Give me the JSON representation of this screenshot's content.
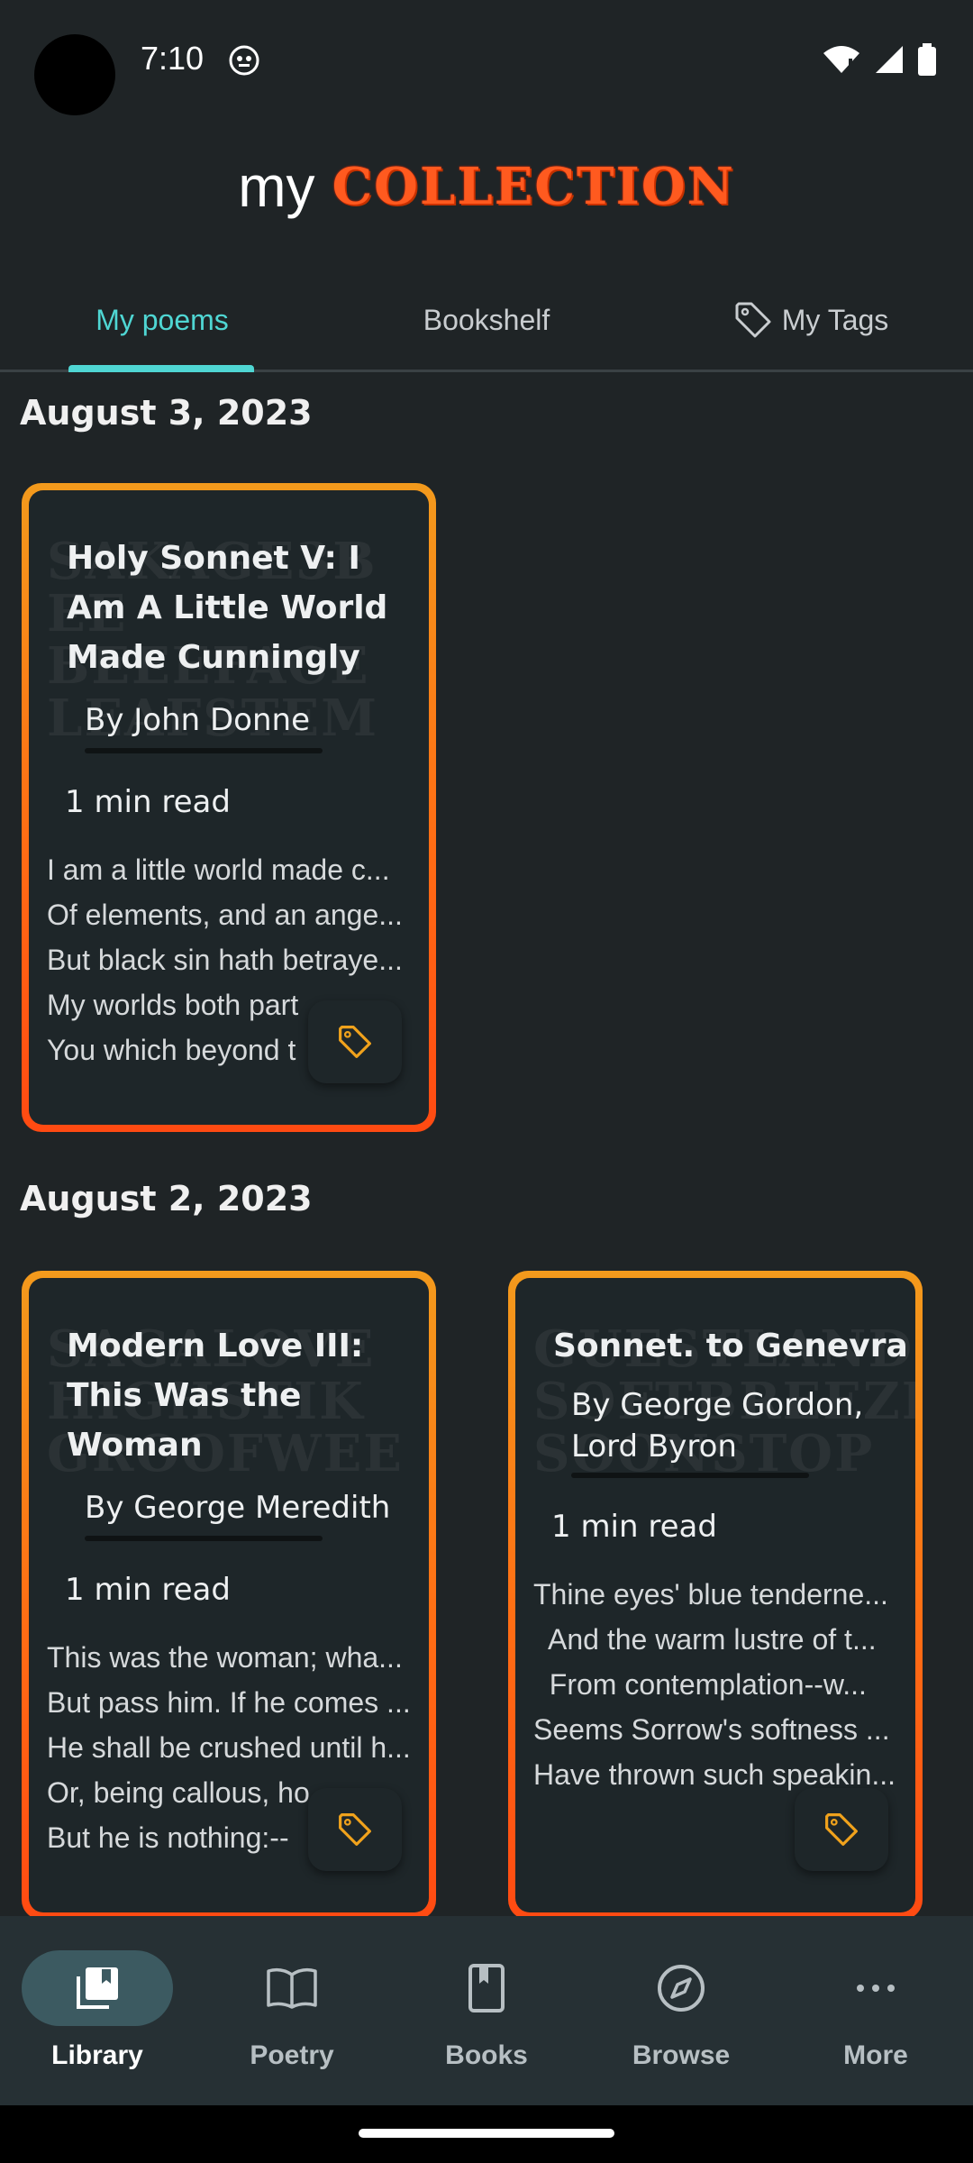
{
  "status_bar": {
    "time": "7:10"
  },
  "header": {
    "prefix": "my",
    "title": "COLLECTION"
  },
  "tabs": [
    {
      "label": "My poems",
      "active": true
    },
    {
      "label": "Bookshelf",
      "active": false
    },
    {
      "label": "My Tags",
      "active": false,
      "icon": "tag-icon"
    }
  ],
  "sections": [
    {
      "date": "August 3, 2023",
      "cards": [
        {
          "title": "Holy Sonnet V: I Am A Little World Made Cunningly",
          "author": "By John Donne",
          "read_time": "1 min read",
          "lines": [
            "I am a little world made c...",
            "Of elements, and an ange...",
            "But black sin hath betraye...",
            "My worlds both part",
            "You which beyond t"
          ]
        }
      ]
    },
    {
      "date": "August 2, 2023",
      "cards": [
        {
          "title": "Modern Love III: This Was the Woman",
          "author": "By George Meredith",
          "read_time": "1 min read",
          "lines": [
            "This was the woman; wha...",
            "But pass him. If he comes ...",
            "He shall be crushed until h...",
            "Or, being callous, ho",
            "But he is nothing:--"
          ]
        },
        {
          "title": "Sonnet.  to Genevra",
          "author": "By George Gordon, Lord Byron",
          "read_time": "1 min read",
          "lines": [
            "Thine eyes' blue tenderne...",
            "  And the warm lustre of t...",
            "  From contemplation--w...",
            "Seems Sorrow's softness ...",
            "Have thrown such speakin..."
          ]
        }
      ]
    }
  ],
  "bottom_nav": [
    {
      "label": "Library",
      "icon": "library-icon",
      "active": true
    },
    {
      "label": "Poetry",
      "icon": "book-open-icon",
      "active": false
    },
    {
      "label": "Books",
      "icon": "bookmark-book-icon",
      "active": false
    },
    {
      "label": "Browse",
      "icon": "compass-icon",
      "active": false
    },
    {
      "label": "More",
      "icon": "more-horizontal-icon",
      "active": false
    }
  ],
  "colors": {
    "accent": "#4fd6d3",
    "card_border": "#ff6d14",
    "tag": "#f0a21c",
    "background": "#1f2426"
  }
}
